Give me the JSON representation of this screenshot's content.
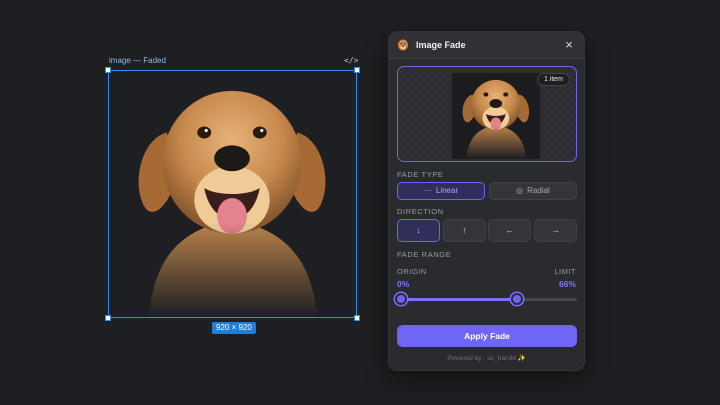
{
  "canvas": {
    "frame_label": "image — Faded",
    "code_icon": "</>",
    "size_badge": "920 × 920"
  },
  "panel": {
    "title": "Image Fade",
    "close_icon": "×",
    "preview": {
      "badge": "1 item"
    },
    "fade_type": {
      "label": "FADE TYPE",
      "options": [
        {
          "label": "Linear",
          "icon": "⋯",
          "selected": true
        },
        {
          "label": "Radial",
          "icon": "◎",
          "selected": false
        }
      ]
    },
    "direction": {
      "label": "DIRECTION",
      "options": [
        {
          "icon": "↓",
          "name": "down",
          "selected": true
        },
        {
          "icon": "↑",
          "name": "up",
          "selected": false
        },
        {
          "icon": "←",
          "name": "left",
          "selected": false
        },
        {
          "icon": "→",
          "name": "right",
          "selected": false
        }
      ]
    },
    "fade_range": {
      "label": "FADE RANGE",
      "origin_label": "ORIGIN",
      "origin_value": "0%",
      "limit_label": "LIMIT",
      "limit_value": "66%",
      "origin": 0,
      "limit": 66
    },
    "apply_label": "Apply Fade",
    "powered_by": "Powered by · ux_harold",
    "powered_spark": "✨"
  },
  "colors": {
    "accent": "#6c63ff",
    "selection": "#2f8ee8",
    "background": "#1e1f22"
  }
}
